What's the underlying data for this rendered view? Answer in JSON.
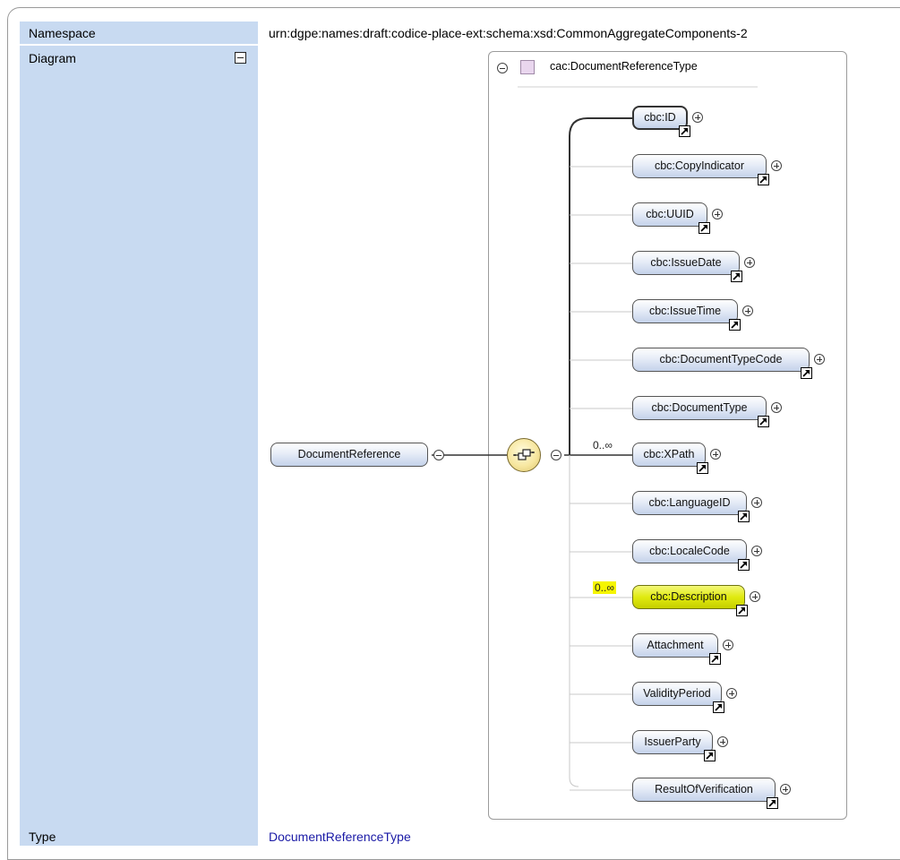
{
  "table": {
    "namespace_label": "Namespace",
    "namespace_value": "urn:dgpe:names:draft:codice-place-ext:schema:xsd:CommonAggregateComponents-2",
    "diagram_label": "Diagram",
    "type_label": "Type",
    "type_value": "DocumentReferenceType"
  },
  "diagram": {
    "type_title": "cac:DocumentReferenceType",
    "root_element": "DocumentReference",
    "cardinality_top": "0..∞",
    "children": [
      {
        "label": "cbc:ID",
        "cardinality": ""
      },
      {
        "label": "cbc:CopyIndicator",
        "cardinality": ""
      },
      {
        "label": "cbc:UUID",
        "cardinality": ""
      },
      {
        "label": "cbc:IssueDate",
        "cardinality": ""
      },
      {
        "label": "cbc:IssueTime",
        "cardinality": ""
      },
      {
        "label": "cbc:DocumentTypeCode",
        "cardinality": ""
      },
      {
        "label": "cbc:DocumentType",
        "cardinality": ""
      },
      {
        "label": "cbc:XPath",
        "cardinality": "0..∞"
      },
      {
        "label": "cbc:LanguageID",
        "cardinality": ""
      },
      {
        "label": "cbc:LocaleCode",
        "cardinality": ""
      },
      {
        "label": "cbc:Description",
        "cardinality": "0..∞"
      },
      {
        "label": "Attachment",
        "cardinality": ""
      },
      {
        "label": "ValidityPeriod",
        "cardinality": ""
      },
      {
        "label": "IssuerParty",
        "cardinality": ""
      },
      {
        "label": "ResultOfVerification",
        "cardinality": ""
      }
    ],
    "colors": {
      "label_column": "#c8daf1",
      "highlight": "#e0ea10",
      "type_swatch": "#e9d6ee"
    }
  }
}
